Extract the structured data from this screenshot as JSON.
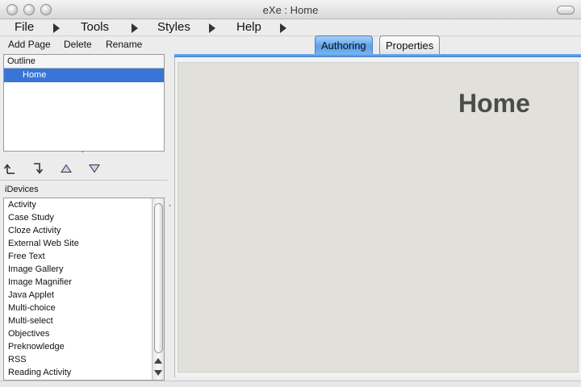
{
  "window": {
    "title": "eXe : Home"
  },
  "menu": {
    "items": [
      "File",
      "Tools",
      "Styles",
      "Help"
    ]
  },
  "toolbar": {
    "add_page": "Add Page",
    "delete": "Delete",
    "rename": "Rename"
  },
  "outline": {
    "header": "Outline",
    "selected_node": "Home"
  },
  "outline_buttons": [
    {
      "icon": "promote-up-icon"
    },
    {
      "icon": "demote-down-icon"
    },
    {
      "icon": "move-up-icon"
    },
    {
      "icon": "move-down-icon"
    }
  ],
  "idevices": {
    "label": "iDevices",
    "items": [
      "Activity",
      "Case Study",
      "Cloze Activity",
      "External Web Site",
      "Free Text",
      "Image Gallery",
      "Image Magnifier",
      "Java Applet",
      "Multi-choice",
      "Multi-select",
      "Objectives",
      "Preknowledge",
      "RSS",
      "Reading Activity"
    ]
  },
  "tabs": {
    "authoring": "Authoring",
    "properties": "Properties",
    "active": "Authoring"
  },
  "content": {
    "heading": "Home"
  },
  "colors": {
    "selection": "#3875d7",
    "active_tab": "#5aa0ea",
    "content_bg": "#e1e0da"
  }
}
